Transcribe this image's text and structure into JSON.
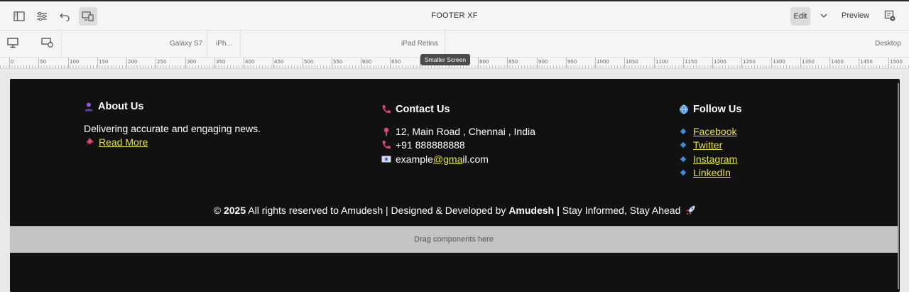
{
  "toolbar": {
    "title": "FOOTER XF",
    "edit_label": "Edit",
    "preview_label": "Preview"
  },
  "emulator": {
    "devices": [
      "Galaxy S7",
      "iPh...",
      "iPad Retina",
      "Desktop"
    ]
  },
  "ruler": {
    "ticks": [
      "0",
      "50",
      "100",
      "150",
      "200",
      "250",
      "300",
      "350",
      "400",
      "450",
      "500",
      "550",
      "600",
      "650",
      "700",
      "750",
      "800",
      "850",
      "900",
      "950",
      "1000",
      "1050",
      "1100",
      "1150",
      "1200",
      "1250",
      "1300",
      "1350",
      "1400",
      "1450",
      "1500"
    ]
  },
  "tooltip": "Smaller Screen",
  "footer": {
    "about": {
      "heading": "About Us",
      "text": "Delivering accurate and engaging news.",
      "read_more": "Read More"
    },
    "contact": {
      "heading": "Contact Us",
      "address": "12, Main Road , Chennai , India",
      "phone": "+91 888888888",
      "email_pre": "example",
      "email_mid": "@gma",
      "email_post": "il.com"
    },
    "follow": {
      "heading": "Follow Us",
      "links": [
        "Facebook",
        "Twitter",
        "Instagram",
        "LinkedIn"
      ]
    },
    "copyright": {
      "prefix": "© ",
      "year": "2025",
      "mid": " All rights reserved to Amudesh | Designed & Developed by ",
      "author": "Amudesh",
      "sep": " |",
      "tagline": " Stay Informed, Stay Ahead"
    }
  },
  "dropzone": "Drag components here",
  "colors": {
    "footer_bg": "#111111",
    "link_yellow": "#e6e040",
    "diamond_blue": "#3d8be0"
  }
}
